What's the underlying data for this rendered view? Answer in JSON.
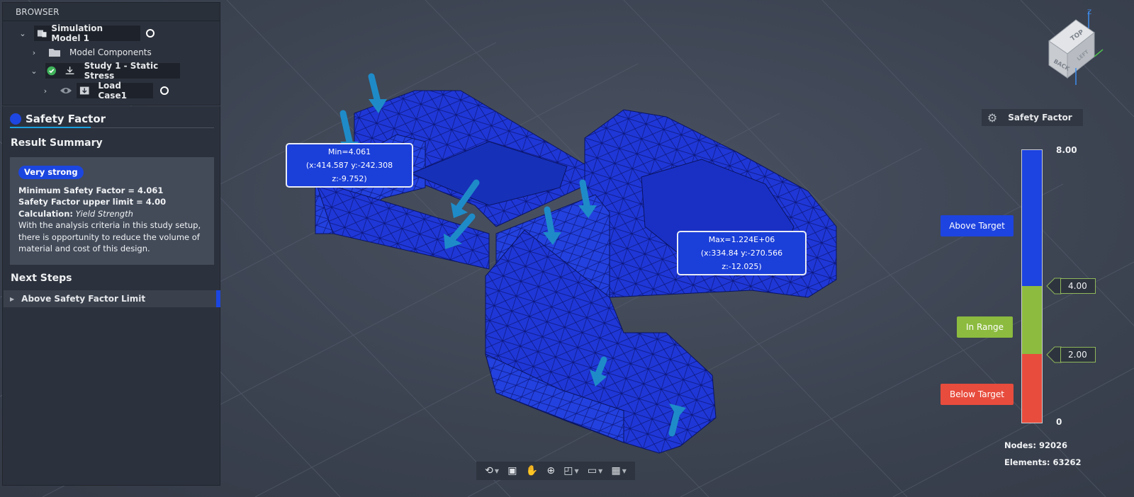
{
  "browser": {
    "title": "BROWSER",
    "items": [
      {
        "label": "Simulation Model 1"
      },
      {
        "label": "Model Components"
      },
      {
        "label": "Study 1 - Static Stress"
      },
      {
        "label": "Load Case1"
      }
    ]
  },
  "result_panel": {
    "tab": "Safety Factor",
    "summary_title": "Result Summary",
    "badge": "Very strong",
    "min_label": "Minimum Safety Factor = 4.061",
    "upper_label": "Safety Factor upper limit = 4.00",
    "calc_label": "Calculation:",
    "calc_value": "Yield Strength",
    "description": "With the analysis criteria in this study setup, there is opportunity to reduce the volume of material and cost of this design.",
    "next_title": "Next Steps",
    "next_item": "Above Safety Factor Limit"
  },
  "callouts": {
    "min_line1": "Min=4.061",
    "min_line2": "(x:414.587 y:-242.308 z:-9.752)",
    "max_line1": "Max=1.224E+06",
    "max_line2": "(x:334.84 y:-270.566 z:-12.025)"
  },
  "legend": {
    "title": "Safety Factor",
    "top": "8.00",
    "upper": "4.00",
    "lower": "2.00",
    "bottom": "0",
    "above_target": "Above Target",
    "in_range": "In Range",
    "below_target": "Below Target",
    "colors": {
      "above": "#1d43e0",
      "in_range": "#8cbb3f",
      "below": "#e84c3d"
    }
  },
  "stats": {
    "nodes": "Nodes: 92026",
    "elements": "Elements: 63262"
  },
  "viewcube": {
    "top": "TOP",
    "back": "BACK",
    "left": "LEFT",
    "axis_z": "Z"
  },
  "toolbar_icons": [
    "orbit-icon",
    "pan-camera-icon",
    "hand-icon",
    "zoom-icon",
    "fit-icon",
    "display-icon",
    "grid-icon"
  ]
}
